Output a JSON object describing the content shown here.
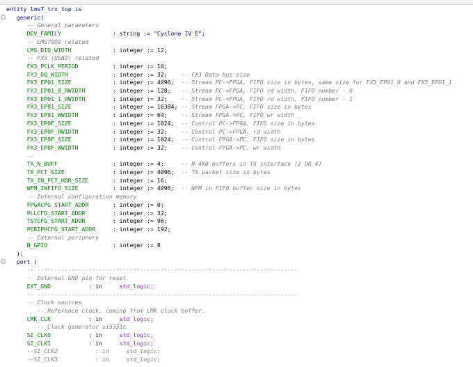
{
  "lines": [
    {
      "indent": "",
      "parts": [
        {
          "t": "entity lms7_trx_top is",
          "c": "kw"
        }
      ]
    },
    {
      "indent": "   ",
      "parts": [
        {
          "t": "generic(",
          "c": "kw"
        }
      ]
    },
    {
      "indent": "      ",
      "parts": [
        {
          "t": "-- General parameters",
          "c": "cm"
        }
      ]
    },
    {
      "indent": "      ",
      "parts": [
        {
          "t": "DEV_FAMILY               ",
          "c": "id"
        },
        {
          "t": ": string := ",
          "c": "op"
        },
        {
          "t": "\"Cyclone IV E\"",
          "c": "st"
        },
        {
          "t": ";",
          "c": "op"
        }
      ]
    },
    {
      "indent": "      ",
      "parts": [
        {
          "t": "-- LMS7002 related",
          "c": "cm"
        }
      ]
    },
    {
      "indent": "      ",
      "parts": [
        {
          "t": "LMS_DIQ_WIDTH            ",
          "c": "id"
        },
        {
          "t": ": integer := 12;",
          "c": "op"
        }
      ]
    },
    {
      "indent": "      ",
      "parts": [
        {
          "t": "-- FX3 (USB3) related",
          "c": "cm"
        }
      ]
    },
    {
      "indent": "      ",
      "parts": [
        {
          "t": "FX3_PCLK_PERIOD          ",
          "c": "id"
        },
        {
          "t": ": integer := 10;",
          "c": "op"
        }
      ]
    },
    {
      "indent": "      ",
      "parts": [
        {
          "t": "FX3_DQ_WIDTH             ",
          "c": "id"
        },
        {
          "t": ": integer := 32;    ",
          "c": "op"
        },
        {
          "t": "-- FX3 Data bus size",
          "c": "cm"
        }
      ]
    },
    {
      "indent": "      ",
      "parts": [
        {
          "t": "FX3_EP01_SIZE            ",
          "c": "id"
        },
        {
          "t": ": integer := 4096;  ",
          "c": "op"
        },
        {
          "t": "-- Stream PC->FPGA, FIFO size in bytes, same size for FX3_EP01_0 and FX3_EP01_1",
          "c": "cm"
        }
      ]
    },
    {
      "indent": "      ",
      "parts": [
        {
          "t": "FX3_EP01_0_RWIDTH        ",
          "c": "id"
        },
        {
          "t": ": integer := 128;   ",
          "c": "op"
        },
        {
          "t": "-- Stream PC->FPGA, FIFO rd width, FIFO number - 0",
          "c": "cm"
        }
      ]
    },
    {
      "indent": "      ",
      "parts": [
        {
          "t": "FX3_EP01_1_RWIDTH        ",
          "c": "id"
        },
        {
          "t": ": integer := 32;    ",
          "c": "op"
        },
        {
          "t": "-- Stream PC->FPGA, FIFO rd width, FIFO number - 1",
          "c": "cm"
        }
      ]
    },
    {
      "indent": "      ",
      "parts": [
        {
          "t": "FX3_EP81_SIZE            ",
          "c": "id"
        },
        {
          "t": ": integer := 16384; ",
          "c": "op"
        },
        {
          "t": "-- Stream FPGA->PC, FIFO size in bytes",
          "c": "cm"
        }
      ]
    },
    {
      "indent": "      ",
      "parts": [
        {
          "t": "FX3_EP81_WWIDTH          ",
          "c": "id"
        },
        {
          "t": ": integer := 64;    ",
          "c": "op"
        },
        {
          "t": "-- Stream FPGA->PC, FIFO wr width",
          "c": "cm"
        }
      ]
    },
    {
      "indent": "      ",
      "parts": [
        {
          "t": "FX3_EP0F_SIZE            ",
          "c": "id"
        },
        {
          "t": ": integer := 1024;  ",
          "c": "op"
        },
        {
          "t": "-- Control PC->FPGA, FIFO size in bytes",
          "c": "cm"
        }
      ]
    },
    {
      "indent": "      ",
      "parts": [
        {
          "t": "FX3_EP0F_RWIDTH          ",
          "c": "id"
        },
        {
          "t": ": integer := 32;    ",
          "c": "op"
        },
        {
          "t": "-- Control PC->FPGA, rd width",
          "c": "cm"
        }
      ]
    },
    {
      "indent": "      ",
      "parts": [
        {
          "t": "FX3_EP8F_SIZE            ",
          "c": "id"
        },
        {
          "t": ": integer := 1024;  ",
          "c": "op"
        },
        {
          "t": "-- Control FPGA->PC, FIFO size in bytes",
          "c": "cm"
        }
      ]
    },
    {
      "indent": "      ",
      "parts": [
        {
          "t": "FX3_EP8F_WWIDTH          ",
          "c": "id"
        },
        {
          "t": ": integer := 32;    ",
          "c": "op"
        },
        {
          "t": "-- Control FPGA->PC, wr width",
          "c": "cm"
        }
      ]
    },
    {
      "indent": "      ",
      "parts": [
        {
          "t": "--",
          "c": "cm"
        }
      ]
    },
    {
      "indent": "      ",
      "parts": [
        {
          "t": "TX_N_BUFF                ",
          "c": "id"
        },
        {
          "t": ": integer := 4;     ",
          "c": "op"
        },
        {
          "t": "-- N 4KB buffers in TX interface (2 OR 4)",
          "c": "cm"
        }
      ]
    },
    {
      "indent": "      ",
      "parts": [
        {
          "t": "TX_PCT_SIZE              ",
          "c": "id"
        },
        {
          "t": ": integer := 4096;  ",
          "c": "op"
        },
        {
          "t": "-- TX packet size in bytes",
          "c": "cm"
        }
      ]
    },
    {
      "indent": "      ",
      "parts": [
        {
          "t": "TX_IN_PCT_HDR_SIZE       ",
          "c": "id"
        },
        {
          "t": ": integer := 16;",
          "c": "op"
        }
      ]
    },
    {
      "indent": "      ",
      "parts": [
        {
          "t": "WFM_INFIFO_SIZE          ",
          "c": "id"
        },
        {
          "t": ": integer := 4096;  ",
          "c": "op"
        },
        {
          "t": "-- WFM in FIFO buffer size in bytes",
          "c": "cm"
        }
      ]
    },
    {
      "indent": "      ",
      "parts": [
        {
          "t": "-- Internal configuration memory",
          "c": "cm"
        }
      ]
    },
    {
      "indent": "      ",
      "parts": [
        {
          "t": "FPGACFG_START_ADDR       ",
          "c": "id"
        },
        {
          "t": ": integer := 0;",
          "c": "op"
        }
      ]
    },
    {
      "indent": "      ",
      "parts": [
        {
          "t": "PLLCFG_START_ADDR        ",
          "c": "id"
        },
        {
          "t": ": integer := 32;",
          "c": "op"
        }
      ]
    },
    {
      "indent": "      ",
      "parts": [
        {
          "t": "TSTCFG_START_ADDR        ",
          "c": "id"
        },
        {
          "t": ": integer := 96;",
          "c": "op"
        }
      ]
    },
    {
      "indent": "      ",
      "parts": [
        {
          "t": "PERIPHCFG_START_ADDR     ",
          "c": "id"
        },
        {
          "t": ": integer := 192;",
          "c": "op"
        }
      ]
    },
    {
      "indent": "      ",
      "parts": [
        {
          "t": "-- External periphery",
          "c": "cm"
        }
      ]
    },
    {
      "indent": "      ",
      "parts": [
        {
          "t": "N_GPIO                   ",
          "c": "id"
        },
        {
          "t": ": integer := 8",
          "c": "op"
        }
      ]
    },
    {
      "indent": "   ",
      "parts": [
        {
          "t": ");",
          "c": "op"
        }
      ]
    },
    {
      "indent": "   ",
      "parts": [
        {
          "t": "port (",
          "c": "kw"
        }
      ]
    },
    {
      "indent": "      ",
      "parts": [
        {
          "t": "-- ----------------------------------------------------------------------------",
          "c": "cm"
        }
      ]
    },
    {
      "indent": "      ",
      "parts": [
        {
          "t": "-- External GND pin for reset",
          "c": "cm"
        }
      ]
    },
    {
      "indent": "      ",
      "parts": [
        {
          "t": "EXT_GND           ",
          "c": "id"
        },
        {
          "t": ": in     ",
          "c": "op"
        },
        {
          "t": "std_logic;",
          "c": "ty2"
        }
      ]
    },
    {
      "indent": "      ",
      "parts": [
        {
          "t": "-- ----------------------------------------------------------------------------",
          "c": "cm"
        }
      ]
    },
    {
      "indent": "      ",
      "parts": [
        {
          "t": "-- Clock sources",
          "c": "cm"
        }
      ]
    },
    {
      "indent": "         ",
      "parts": [
        {
          "t": "-- Reference clock, coming from LMK clock buffer.",
          "c": "cm"
        }
      ]
    },
    {
      "indent": "      ",
      "parts": [
        {
          "t": "LMK_CLK           ",
          "c": "id"
        },
        {
          "t": ": in     ",
          "c": "op"
        },
        {
          "t": "std_logic;",
          "c": "ty2"
        }
      ]
    },
    {
      "indent": "         ",
      "parts": [
        {
          "t": "-- Clock generator si5351c",
          "c": "cm"
        }
      ]
    },
    {
      "indent": "      ",
      "parts": [
        {
          "t": "SI_CLK0           ",
          "c": "id"
        },
        {
          "t": ": in     ",
          "c": "op"
        },
        {
          "t": "std_logic;",
          "c": "ty2"
        }
      ]
    },
    {
      "indent": "      ",
      "parts": [
        {
          "t": "SI_CLK1           ",
          "c": "id"
        },
        {
          "t": ": in     ",
          "c": "op"
        },
        {
          "t": "std_logic;",
          "c": "ty2"
        }
      ]
    },
    {
      "indent": "      ",
      "parts": [
        {
          "t": "--SI_CLK2           : in     std_logic;",
          "c": "cm"
        }
      ]
    },
    {
      "indent": "      ",
      "parts": [
        {
          "t": "--SI_CLK3           : in     std_logic;",
          "c": "cm"
        }
      ]
    }
  ],
  "gutter": {
    "fold_icon": "fold-toggle-icon"
  },
  "colors": {
    "keyword": "#00008b",
    "identifier": "#008000",
    "comment": "#7a7a7a",
    "string": "#000080",
    "type": "#7a2e9b"
  }
}
